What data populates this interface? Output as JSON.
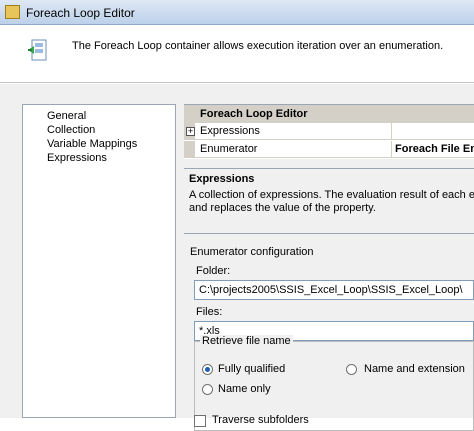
{
  "window": {
    "title": "Foreach Loop Editor"
  },
  "header": {
    "description": "The Foreach Loop container allows execution iteration over an enumeration."
  },
  "nav": {
    "items": [
      "General",
      "Collection",
      "Variable Mappings",
      "Expressions"
    ],
    "selected": "Collection"
  },
  "property_grid": {
    "category": "Foreach Loop Editor",
    "rows": [
      {
        "name": "Expressions",
        "value": "",
        "expander": "+"
      },
      {
        "name": "Enumerator",
        "value": "Foreach File Enu"
      }
    ]
  },
  "description_panel": {
    "title": "Expressions",
    "line1": "A collection of expressions. The evaluation result of each expre",
    "line2": "and replaces the value of the property."
  },
  "enumerator_config": {
    "section_label": "Enumerator configuration",
    "folder_label": "Folder:",
    "folder_value": "C:\\projects2005\\SSIS_Excel_Loop\\SSIS_Excel_Loop\\",
    "files_label": "Files:",
    "files_value": "*.xls",
    "retrieve_group_label": "Retrieve file name",
    "options": {
      "fully_qualified": "Fully qualified",
      "name_and_extension": "Name and extension",
      "name_only": "Name only"
    },
    "selected_option": "fully_qualified",
    "traverse_label": "Traverse subfolders",
    "traverse_checked": false
  },
  "colors": {
    "selection": "#316ac5",
    "title_bar": "#bcd1ea",
    "panel_bg": "#f0f0f0"
  }
}
